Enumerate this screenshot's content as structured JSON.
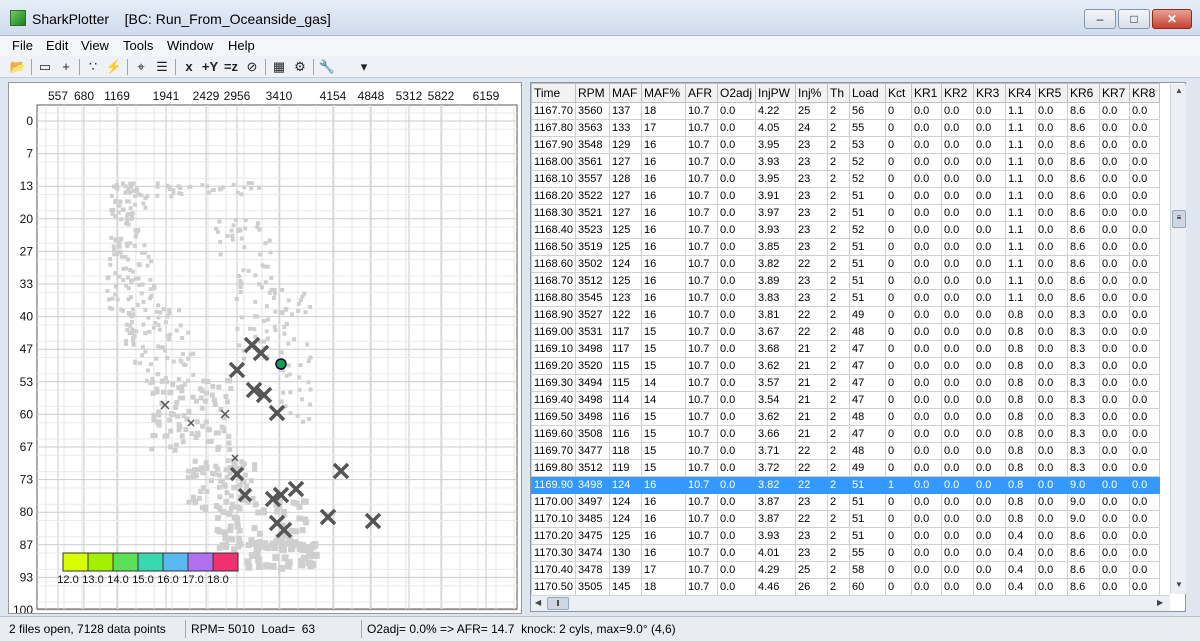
{
  "window": {
    "app_name": "SharkPlotter",
    "title": "SharkPlotter    [BC: Run_From_Oceanside_gas]",
    "min_label": "–",
    "max_label": "□",
    "close_label": "✕"
  },
  "menu": [
    "File",
    "Edit",
    "View",
    "Tools",
    "Window",
    "Help"
  ],
  "toolbar": {
    "icons": [
      "open-folder-icon",
      "rectangle-icon",
      "plus-icon",
      "scatter-icon",
      "lightning-icon",
      "grid-cross-icon",
      "list-icon",
      "x-axis-icon",
      "y-axis-icon",
      "z-axis-icon",
      "circle-slash-icon",
      "table-icon",
      "grid-settings-icon",
      "wrench-icon",
      "dropdown-arrow-icon"
    ],
    "labels": [
      "📂",
      "▭",
      "+",
      "∵",
      "⚡",
      "⌖",
      "☰",
      "x",
      "+Y",
      "=z",
      "⊘",
      "▦",
      "⚙",
      "🔧",
      "▾"
    ]
  },
  "plot": {
    "x_axis_labels": [
      "557",
      "680",
      "1169",
      "1941",
      "2429",
      "2956",
      "3410",
      "4154",
      "4848",
      "5312",
      "5822",
      "6159"
    ],
    "y_axis_labels": [
      "0",
      "7",
      "13",
      "20",
      "27",
      "33",
      "40",
      "47",
      "53",
      "60",
      "67",
      "73",
      "80",
      "87",
      "93",
      "100"
    ],
    "legend": {
      "labels": [
        "12.0",
        "13.0",
        "14.0",
        "15.0",
        "16.0",
        "17.0",
        "18.0"
      ],
      "colors": [
        "#d8ff00",
        "#a0f000",
        "#5ae05a",
        "#3ad8b0",
        "#59b8f0",
        "#b070f0",
        "#f03070"
      ]
    },
    "point_color": "#cfcfcf",
    "knock_marker_color": "#555555",
    "cursor_marker_color": "#12a050"
  },
  "table": {
    "columns": [
      "Time",
      "RPM",
      "MAF",
      "MAF%",
      "AFR",
      "O2adj",
      "InjPW",
      "Inj%",
      "Th",
      "Load",
      "Kct",
      "KR1",
      "KR2",
      "KR3",
      "KR4",
      "KR5",
      "KR6",
      "KR7",
      "KR8"
    ],
    "rows": [
      [
        "1167.70",
        "3560",
        "137",
        "18",
        "10.7",
        "0.0",
        "4.22",
        "25",
        "2",
        "56",
        "0",
        "0.0",
        "0.0",
        "0.0",
        "1.1",
        "0.0",
        "8.6",
        "0.0",
        "0.0"
      ],
      [
        "1167.80",
        "3563",
        "133",
        "17",
        "10.7",
        "0.0",
        "4.05",
        "24",
        "2",
        "55",
        "0",
        "0.0",
        "0.0",
        "0.0",
        "1.1",
        "0.0",
        "8.6",
        "0.0",
        "0.0"
      ],
      [
        "1167.90",
        "3548",
        "129",
        "16",
        "10.7",
        "0.0",
        "3.95",
        "23",
        "2",
        "53",
        "0",
        "0.0",
        "0.0",
        "0.0",
        "1.1",
        "0.0",
        "8.6",
        "0.0",
        "0.0"
      ],
      [
        "1168.00",
        "3561",
        "127",
        "16",
        "10.7",
        "0.0",
        "3.93",
        "23",
        "2",
        "52",
        "0",
        "0.0",
        "0.0",
        "0.0",
        "1.1",
        "0.0",
        "8.6",
        "0.0",
        "0.0"
      ],
      [
        "1168.10",
        "3557",
        "128",
        "16",
        "10.7",
        "0.0",
        "3.95",
        "23",
        "2",
        "52",
        "0",
        "0.0",
        "0.0",
        "0.0",
        "1.1",
        "0.0",
        "8.6",
        "0.0",
        "0.0"
      ],
      [
        "1168.20",
        "3522",
        "127",
        "16",
        "10.7",
        "0.0",
        "3.91",
        "23",
        "2",
        "51",
        "0",
        "0.0",
        "0.0",
        "0.0",
        "1.1",
        "0.0",
        "8.6",
        "0.0",
        "0.0"
      ],
      [
        "1168.30",
        "3521",
        "127",
        "16",
        "10.7",
        "0.0",
        "3.97",
        "23",
        "2",
        "51",
        "0",
        "0.0",
        "0.0",
        "0.0",
        "1.1",
        "0.0",
        "8.6",
        "0.0",
        "0.0"
      ],
      [
        "1168.40",
        "3523",
        "125",
        "16",
        "10.7",
        "0.0",
        "3.93",
        "23",
        "2",
        "52",
        "0",
        "0.0",
        "0.0",
        "0.0",
        "1.1",
        "0.0",
        "8.6",
        "0.0",
        "0.0"
      ],
      [
        "1168.50",
        "3519",
        "125",
        "16",
        "10.7",
        "0.0",
        "3.85",
        "23",
        "2",
        "51",
        "0",
        "0.0",
        "0.0",
        "0.0",
        "1.1",
        "0.0",
        "8.6",
        "0.0",
        "0.0"
      ],
      [
        "1168.60",
        "3502",
        "124",
        "16",
        "10.7",
        "0.0",
        "3.82",
        "22",
        "2",
        "51",
        "0",
        "0.0",
        "0.0",
        "0.0",
        "1.1",
        "0.0",
        "8.6",
        "0.0",
        "0.0"
      ],
      [
        "1168.70",
        "3512",
        "125",
        "16",
        "10.7",
        "0.0",
        "3.89",
        "23",
        "2",
        "51",
        "0",
        "0.0",
        "0.0",
        "0.0",
        "1.1",
        "0.0",
        "8.6",
        "0.0",
        "0.0"
      ],
      [
        "1168.80",
        "3545",
        "123",
        "16",
        "10.7",
        "0.0",
        "3.83",
        "23",
        "2",
        "51",
        "0",
        "0.0",
        "0.0",
        "0.0",
        "1.1",
        "0.0",
        "8.6",
        "0.0",
        "0.0"
      ],
      [
        "1168.90",
        "3527",
        "122",
        "16",
        "10.7",
        "0.0",
        "3.81",
        "22",
        "2",
        "49",
        "0",
        "0.0",
        "0.0",
        "0.0",
        "0.8",
        "0.0",
        "8.3",
        "0.0",
        "0.0"
      ],
      [
        "1169.00",
        "3531",
        "117",
        "15",
        "10.7",
        "0.0",
        "3.67",
        "22",
        "2",
        "48",
        "0",
        "0.0",
        "0.0",
        "0.0",
        "0.8",
        "0.0",
        "8.3",
        "0.0",
        "0.0"
      ],
      [
        "1169.10",
        "3498",
        "117",
        "15",
        "10.7",
        "0.0",
        "3.68",
        "21",
        "2",
        "47",
        "0",
        "0.0",
        "0.0",
        "0.0",
        "0.8",
        "0.0",
        "8.3",
        "0.0",
        "0.0"
      ],
      [
        "1169.20",
        "3520",
        "115",
        "15",
        "10.7",
        "0.0",
        "3.62",
        "21",
        "2",
        "47",
        "0",
        "0.0",
        "0.0",
        "0.0",
        "0.8",
        "0.0",
        "8.3",
        "0.0",
        "0.0"
      ],
      [
        "1169.30",
        "3494",
        "115",
        "14",
        "10.7",
        "0.0",
        "3.57",
        "21",
        "2",
        "47",
        "0",
        "0.0",
        "0.0",
        "0.0",
        "0.8",
        "0.0",
        "8.3",
        "0.0",
        "0.0"
      ],
      [
        "1169.40",
        "3498",
        "114",
        "14",
        "10.7",
        "0.0",
        "3.54",
        "21",
        "2",
        "47",
        "0",
        "0.0",
        "0.0",
        "0.0",
        "0.8",
        "0.0",
        "8.3",
        "0.0",
        "0.0"
      ],
      [
        "1169.50",
        "3498",
        "116",
        "15",
        "10.7",
        "0.0",
        "3.62",
        "21",
        "2",
        "48",
        "0",
        "0.0",
        "0.0",
        "0.0",
        "0.8",
        "0.0",
        "8.3",
        "0.0",
        "0.0"
      ],
      [
        "1169.60",
        "3508",
        "116",
        "15",
        "10.7",
        "0.0",
        "3.66",
        "21",
        "2",
        "47",
        "0",
        "0.0",
        "0.0",
        "0.0",
        "0.8",
        "0.0",
        "8.3",
        "0.0",
        "0.0"
      ],
      [
        "1169.70",
        "3477",
        "118",
        "15",
        "10.7",
        "0.0",
        "3.71",
        "22",
        "2",
        "48",
        "0",
        "0.0",
        "0.0",
        "0.0",
        "0.8",
        "0.0",
        "8.3",
        "0.0",
        "0.0"
      ],
      [
        "1169.80",
        "3512",
        "119",
        "15",
        "10.7",
        "0.0",
        "3.72",
        "22",
        "2",
        "49",
        "0",
        "0.0",
        "0.0",
        "0.0",
        "0.8",
        "0.0",
        "8.3",
        "0.0",
        "0.0"
      ],
      [
        "1169.90",
        "3498",
        "124",
        "16",
        "10.7",
        "0.0",
        "3.82",
        "22",
        "2",
        "51",
        "1",
        "0.0",
        "0.0",
        "0.0",
        "0.8",
        "0.0",
        "9.0",
        "0.0",
        "0.0"
      ],
      [
        "1170.00",
        "3497",
        "124",
        "16",
        "10.7",
        "0.0",
        "3.87",
        "23",
        "2",
        "51",
        "0",
        "0.0",
        "0.0",
        "0.0",
        "0.8",
        "0.0",
        "9.0",
        "0.0",
        "0.0"
      ],
      [
        "1170.10",
        "3485",
        "124",
        "16",
        "10.7",
        "0.0",
        "3.87",
        "22",
        "2",
        "51",
        "0",
        "0.0",
        "0.0",
        "0.0",
        "0.8",
        "0.0",
        "9.0",
        "0.0",
        "0.0"
      ],
      [
        "1170.20",
        "3475",
        "125",
        "16",
        "10.7",
        "0.0",
        "3.93",
        "23",
        "2",
        "51",
        "0",
        "0.0",
        "0.0",
        "0.0",
        "0.4",
        "0.0",
        "8.6",
        "0.0",
        "0.0"
      ],
      [
        "1170.30",
        "3474",
        "130",
        "16",
        "10.7",
        "0.0",
        "4.01",
        "23",
        "2",
        "55",
        "0",
        "0.0",
        "0.0",
        "0.0",
        "0.4",
        "0.0",
        "8.6",
        "0.0",
        "0.0"
      ],
      [
        "1170.40",
        "3478",
        "139",
        "17",
        "10.7",
        "0.0",
        "4.29",
        "25",
        "2",
        "58",
        "0",
        "0.0",
        "0.0",
        "0.0",
        "0.4",
        "0.0",
        "8.6",
        "0.0",
        "0.0"
      ],
      [
        "1170.50",
        "3505",
        "145",
        "18",
        "10.7",
        "0.0",
        "4.46",
        "26",
        "2",
        "60",
        "0",
        "0.0",
        "0.0",
        "0.0",
        "0.4",
        "0.0",
        "8.6",
        "0.0",
        "0.0"
      ]
    ],
    "selected_row_index": 22,
    "selection_color": "#3399ff"
  },
  "status": {
    "files": "2 files open, 7128 data points",
    "rpm_load": "RPM= 5010  Load=  63",
    "o2": "O2adj= 0.0% => AFR= 14.7  knock: 2 cyls, max=9.0° (4,6)"
  }
}
